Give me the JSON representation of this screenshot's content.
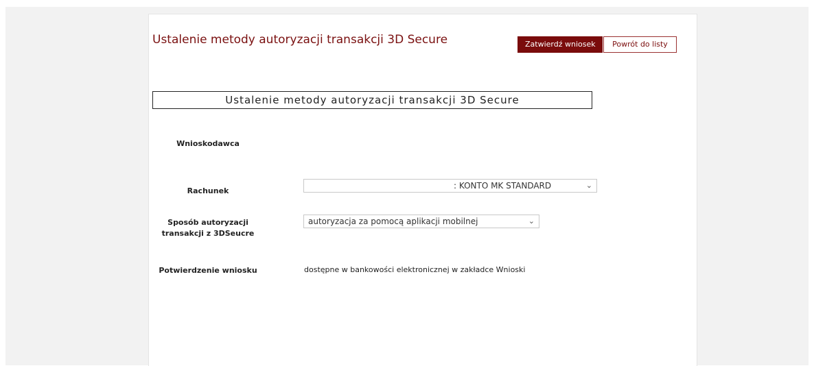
{
  "header": {
    "title": "Ustalenie metody autoryzacji transakcji 3D Secure",
    "confirm_button": "Zatwierdź wniosek",
    "back_button": "Powrót do listy"
  },
  "section": {
    "title": "Ustalenie metody autoryzacji transakcji 3D Secure"
  },
  "form": {
    "applicant_label": "Wnioskodawca",
    "account_label": "Rachunek",
    "account_value": ": KONTO MK STANDARD",
    "auth_method_label": "Sposób autoryzacji transakcji z 3DSeucre",
    "auth_method_value": "autoryzacja za pomocą aplikacji mobilnej",
    "confirmation_label": "Potwierdzenie wniosku",
    "confirmation_value": "dostępne w bankowości elektronicznej w zakładce Wnioski"
  },
  "icons": {
    "dropdown": "chevron-down-icon"
  },
  "colors": {
    "brand": "#7a0c0c",
    "background": "#f2f2f2"
  }
}
